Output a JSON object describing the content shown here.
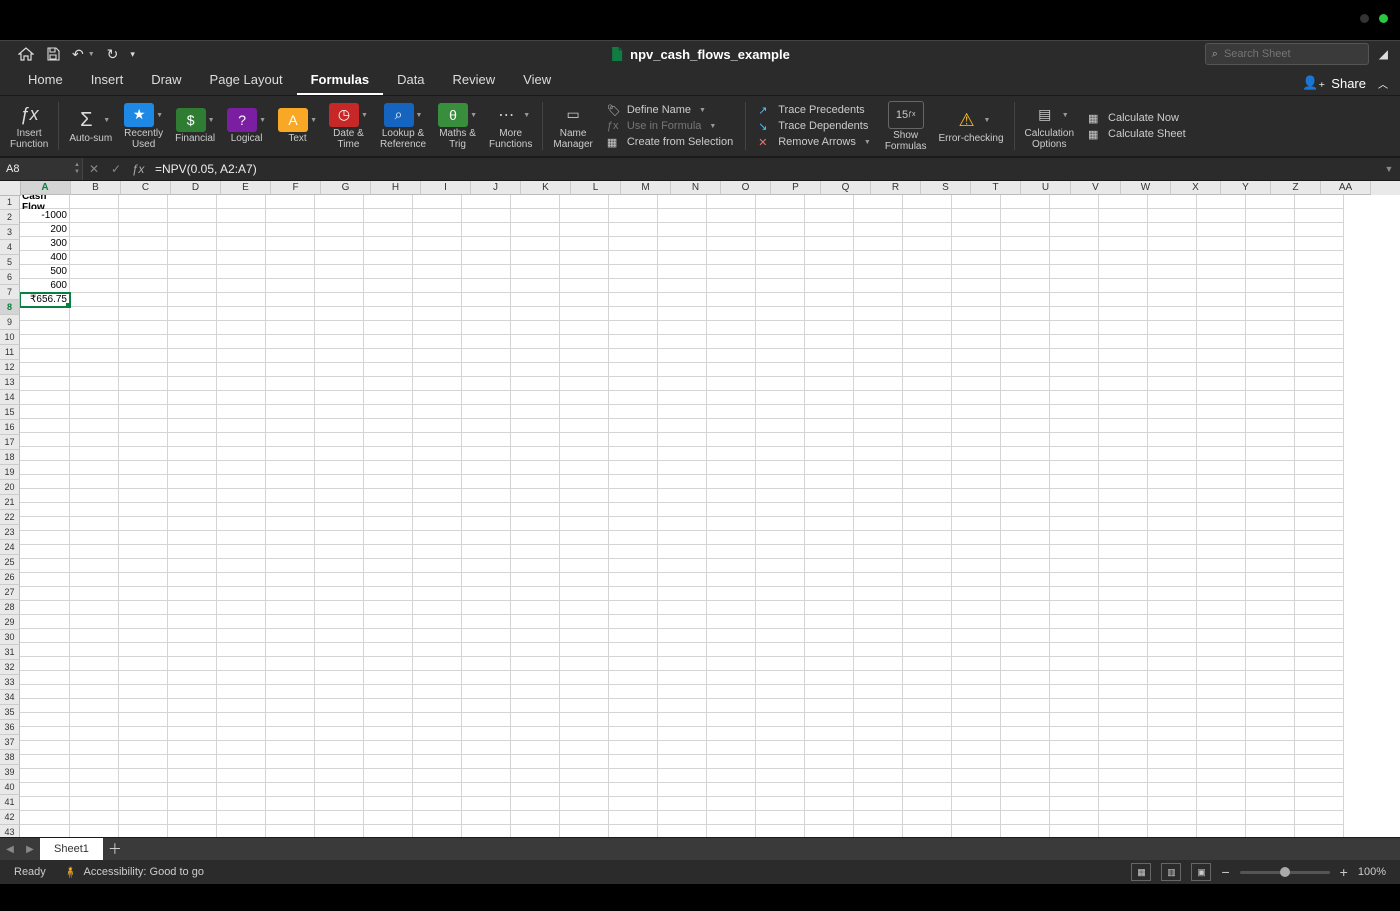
{
  "document_title": "npv_cash_flows_example",
  "search_placeholder": "Search Sheet",
  "menu_tabs": [
    "Home",
    "Insert",
    "Draw",
    "Page Layout",
    "Formulas",
    "Data",
    "Review",
    "View"
  ],
  "active_menu_tab": "Formulas",
  "share_label": "Share",
  "ribbon": {
    "insert_function": "Insert\nFunction",
    "auto_sum": "Auto-sum",
    "recently_used": "Recently\nUsed",
    "financial": "Financial",
    "logical": "Logical",
    "text": "Text",
    "date_time": "Date &\nTime",
    "lookup_ref": "Lookup &\nReference",
    "maths_trig": "Maths &\nTrig",
    "more_functions": "More\nFunctions",
    "name_manager": "Name\nManager",
    "define_name": "Define Name",
    "use_in_formula": "Use in Formula",
    "create_from_selection": "Create from Selection",
    "trace_precedents": "Trace Precedents",
    "trace_dependents": "Trace Dependents",
    "remove_arrows": "Remove Arrows",
    "show_formulas": "Show\nFormulas",
    "error_checking": "Error-checking",
    "calc_options": "Calculation\nOptions",
    "calculate_now": "Calculate Now",
    "calculate_sheet": "Calculate Sheet"
  },
  "name_box": "A8",
  "formula": "=NPV(0.05, A2:A7)",
  "columns": [
    "A",
    "B",
    "C",
    "D",
    "E",
    "F",
    "G",
    "H",
    "I",
    "J",
    "K",
    "L",
    "M",
    "N",
    "O",
    "P",
    "Q",
    "R",
    "S",
    "T",
    "U",
    "V",
    "W",
    "X",
    "Y",
    "Z",
    "AA"
  ],
  "col_A_width": 50,
  "default_col_width": 49,
  "row_count": 46,
  "selected_cell": {
    "row": 8,
    "col": 0
  },
  "cell_data": {
    "A1": {
      "v": "Cash Flow",
      "bold": true,
      "align": "center"
    },
    "A2": {
      "v": "-1000"
    },
    "A3": {
      "v": "200"
    },
    "A4": {
      "v": "300"
    },
    "A5": {
      "v": "400"
    },
    "A6": {
      "v": "500"
    },
    "A7": {
      "v": "600"
    },
    "A8": {
      "v": "₹656.75"
    }
  },
  "sheet_tabs": [
    "Sheet1"
  ],
  "active_sheet": "Sheet1",
  "status": {
    "ready": "Ready",
    "accessibility": "Accessibility: Good to go",
    "zoom": "100%"
  }
}
